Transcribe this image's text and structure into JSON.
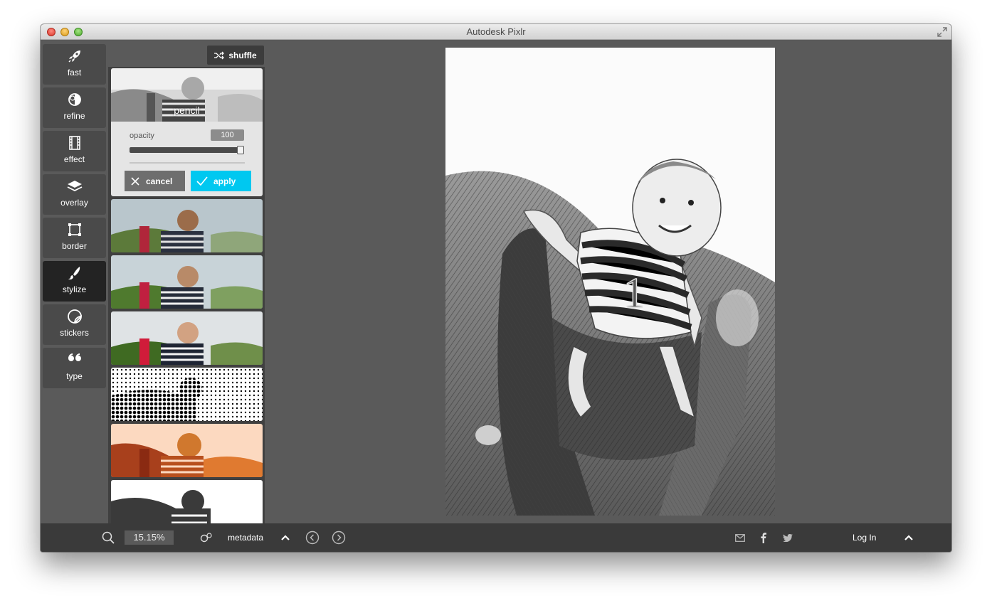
{
  "window": {
    "title": "Autodesk Pixlr"
  },
  "tools": [
    {
      "label": "fast",
      "icon": "rocket-icon"
    },
    {
      "label": "refine",
      "icon": "adjust-icon"
    },
    {
      "label": "effect",
      "icon": "film-icon"
    },
    {
      "label": "overlay",
      "icon": "layers-icon"
    },
    {
      "label": "border",
      "icon": "border-frame-icon"
    },
    {
      "label": "stylize",
      "icon": "brush-icon",
      "active": true
    },
    {
      "label": "stickers",
      "icon": "sticker-icon"
    },
    {
      "label": "type",
      "icon": "quote-icon"
    }
  ],
  "panel": {
    "shuffle_label": "shuffle",
    "selected_effect": "pencil",
    "opacity_label": "opacity",
    "opacity_value": "100",
    "cancel_label": "cancel",
    "apply_label": "apply",
    "accent_color": "#00c8f0"
  },
  "bottom": {
    "zoom": "15.15%",
    "metadata_label": "metadata",
    "login_label": "Log In"
  }
}
